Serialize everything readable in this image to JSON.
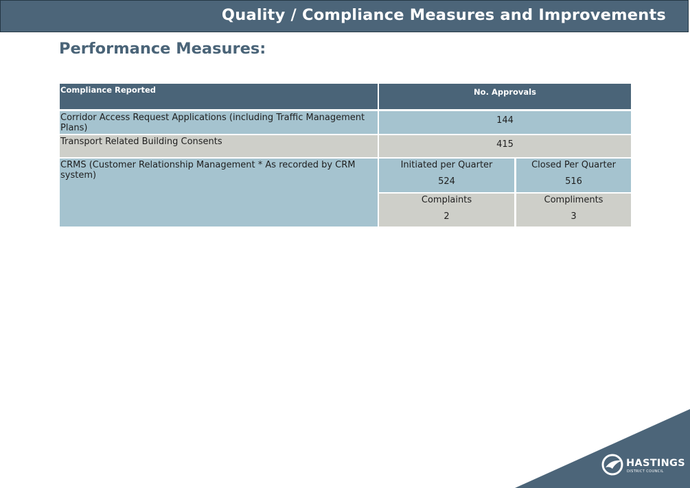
{
  "header": {
    "title": "Quality / Compliance Measures and Improvements"
  },
  "page": {
    "title": "Performance Measures:"
  },
  "table": {
    "header": {
      "col1": "Compliance Reported",
      "col2": "No. Approvals"
    },
    "rows": [
      {
        "label": "Corridor Access Request Applications (including Traffic Management Plans)",
        "value": "144"
      },
      {
        "label": "Transport Related Building Consents",
        "value": "415"
      }
    ],
    "crms": {
      "label": "CRMS (Customer Relationship Management * As recorded by CRM system)",
      "initiated_label": "Initiated per Quarter",
      "initiated_value": "524",
      "closed_label": "Closed Per Quarter",
      "closed_value": "516",
      "complaints_label": "Complaints",
      "complaints_value": "2",
      "compliments_label": "Compliments",
      "compliments_value": "3"
    }
  },
  "logo": {
    "name": "HASTINGS",
    "subtitle": "DISTRICT COUNCIL",
    "icon": "bird-icon"
  },
  "colors": {
    "header_bg": "#4c6579",
    "table_header": "#4a6478",
    "row_blue": "#a5c3cf",
    "row_grey": "#cecfc9"
  }
}
